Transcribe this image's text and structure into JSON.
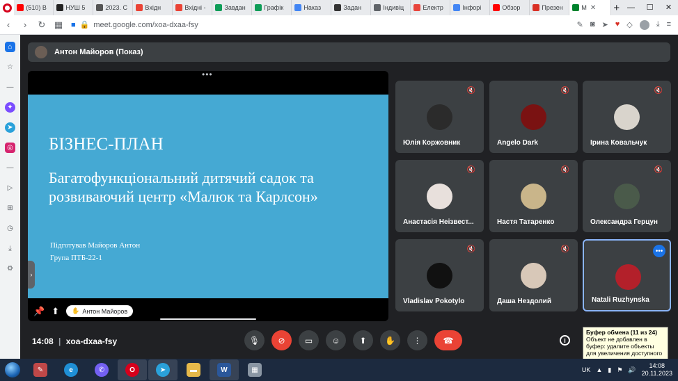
{
  "browser": {
    "tabs": [
      {
        "label": "(510) В",
        "color": "#ff0000"
      },
      {
        "label": "НУШ 5",
        "color": "#222222"
      },
      {
        "label": "2023. С",
        "color": "#555555"
      },
      {
        "label": "Вхідн",
        "color": "#ea4335"
      },
      {
        "label": "Вхідні -",
        "color": "#ea4335"
      },
      {
        "label": "Завдан",
        "color": "#0f9d58"
      },
      {
        "label": "Графік",
        "color": "#0f9d58"
      },
      {
        "label": "Наказ",
        "color": "#4285f4"
      },
      {
        "label": "Задан",
        "color": "#333333"
      },
      {
        "label": "Індивіц",
        "color": "#5f6368"
      },
      {
        "label": "Електр",
        "color": "#e8453c"
      },
      {
        "label": "Інфорі",
        "color": "#4285f4"
      },
      {
        "label": "Обзор",
        "color": "#ff0000"
      },
      {
        "label": "Презен",
        "color": "#d93025"
      },
      {
        "label": "М",
        "color": "#00832d",
        "active": true
      }
    ],
    "new_tab": "+",
    "url": "meet.google.com/xoa-dxaa-fsy"
  },
  "presenter_bar": {
    "label": "Антон Майоров (Показ)"
  },
  "slide": {
    "title": "БІЗНЕС-ПЛАН",
    "subtitle": "Багатофункціональний дитячий садок та розвиваючий центр «Малюк та Карлсон»",
    "prepared_by": "Підготував Майоров Антон",
    "group": "Група ПТБ-22-1"
  },
  "stage": {
    "presenter_name": "Антон Майоров"
  },
  "participants": [
    {
      "name": "Юлія Коржовник",
      "avatar_color": "#2b2b2b"
    },
    {
      "name": "Angelo Dark",
      "avatar_color": "#7a1212"
    },
    {
      "name": "Ірина Ковальчук",
      "avatar_color": "#d9d4cc"
    },
    {
      "name": "Анастасія Неізвест...",
      "avatar_color": "#e8e0dc"
    },
    {
      "name": "Настя Татаренко",
      "avatar_color": "#c9b58a"
    },
    {
      "name": "Олександра Герцун",
      "avatar_color": "#4a5a4a"
    },
    {
      "name": "Vladislav Pokotylo",
      "avatar_color": "#111111"
    },
    {
      "name": "Даша Нездолий",
      "avatar_color": "#d8c8b8"
    },
    {
      "name": "Natali Ruzhynska",
      "avatar_color": "#b3202a",
      "highlighted": true
    }
  ],
  "meeting": {
    "time": "14:08",
    "separator": "|",
    "code": "xoa-dxaa-fsy"
  },
  "clipboard_notice": {
    "title": "Буфер обмена (11 из 24)",
    "message": "Объект не добавлен в буфер: удалите объекты для увеличения доступного места"
  },
  "taskbar": {
    "language": "UK",
    "time": "14:08",
    "date": "20.11.2023"
  }
}
